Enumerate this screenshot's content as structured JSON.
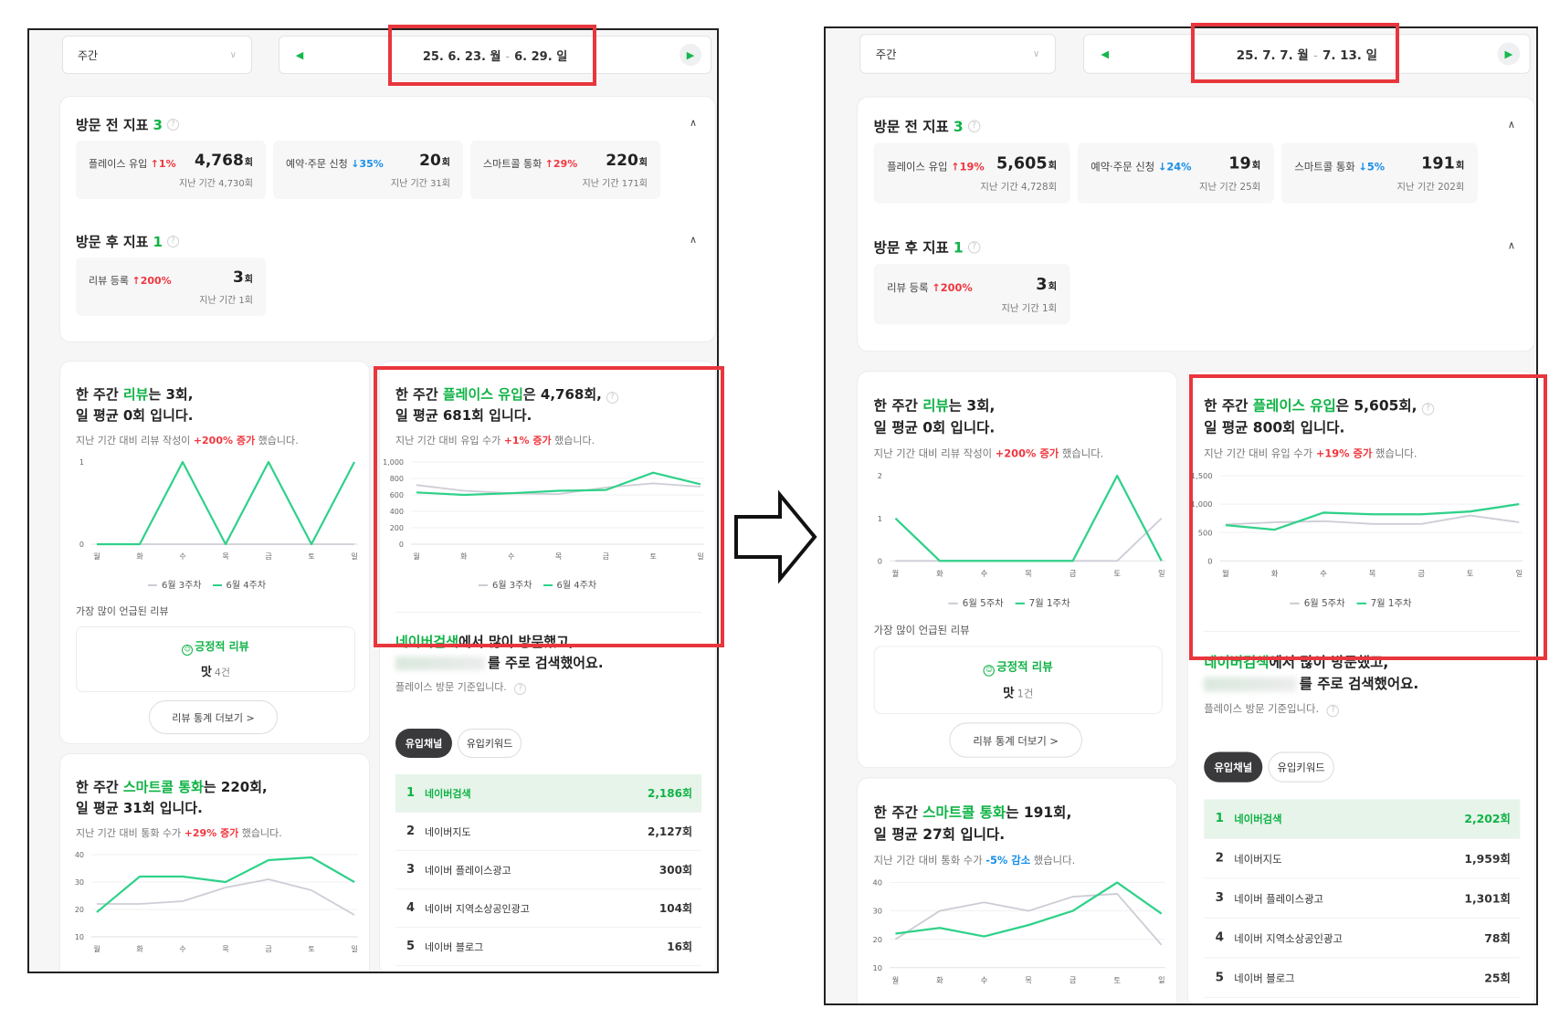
{
  "colors": {
    "accent_green": "#10b346",
    "increase_red": "#f0373e",
    "decrease_blue": "#1a8fe8",
    "previous_gray": "#cdcdd6",
    "highlight_red": "#e8363c"
  },
  "icons": {
    "prev_arrow": "triangle-left-icon",
    "next_arrow": "triangle-right-icon",
    "help": "question-circle-icon",
    "transition": "outline-right-arrow-icon",
    "positive": "smiley-icon"
  },
  "left": {
    "period": "주간",
    "date_start": "25. 6. 23. 월",
    "date_end": "6. 29. 일",
    "pre_title": "방문 전 지표",
    "pre_count": "3",
    "metrics": [
      {
        "label": "플레이스 유입",
        "change": "↑1%",
        "value": "4,768",
        "unit": "회",
        "prev": "지난 기간 4,730회"
      },
      {
        "label": "예약·주문 신청",
        "change": "↓35%",
        "value": "20",
        "unit": "회",
        "prev": "지난 기간 31회"
      },
      {
        "label": "스마트콜 통화",
        "change": "↑29%",
        "value": "220",
        "unit": "회",
        "prev": "지난 기간 171회"
      }
    ],
    "post_title": "방문 후 지표",
    "post_count": "1",
    "post_metric": {
      "label": "리뷰 등록",
      "change": "↑200%",
      "value": "3",
      "unit": "회",
      "prev": "지난 기간 1회"
    },
    "review_card": {
      "l1a": "한 주간 ",
      "l1hl": "리뷰",
      "l1b": "는 3회,",
      "l2": "일 평균 0회 입니다.",
      "sub_a": "지난 기간 대비 리뷰 작성이 ",
      "sub_hl": "+200% 증가",
      "sub_b": " 했습니다.",
      "most": "가장 많이 언급된 리뷰",
      "positive": "긍정적 리뷰",
      "keyword": "맛",
      "keyword_count": "4건",
      "more": "리뷰 통계 더보기 >"
    },
    "place_card": {
      "l1a": "한 주간 ",
      "l1hl": "플레이스 유입",
      "l1b": "은 4,768회,",
      "l2": "일 평균 681회 입니다.",
      "sub_a": "지난 기간 대비 유입 수가 ",
      "sub_hl": "+1% 증가",
      "sub_b": " 했습니다."
    },
    "call_card": {
      "l1a": "한 주간 ",
      "l1hl": "스마트콜 통화",
      "l1b": "는 220회,",
      "l2": "일 평균 31회 입니다.",
      "sub_a": "지난 기간 대비 통화 수가 ",
      "sub_hl": "+29% 증가",
      "sub_b": " 했습니다."
    },
    "channel": {
      "l1hl": "네이버검색",
      "l1b": "에서 많이 방문했고,",
      "l2": "를 주로 검색했어요.",
      "sub": "플레이스 방문 기준입니다.",
      "tab_on": "유입채널",
      "tab_off": "유입키워드",
      "rows": [
        {
          "rank": "1",
          "name": "네이버검색",
          "value": "2,186회"
        },
        {
          "rank": "2",
          "name": "네이버지도",
          "value": "2,127회"
        },
        {
          "rank": "3",
          "name": "네이버 플레이스광고",
          "value": "300회"
        },
        {
          "rank": "4",
          "name": "네이버 지역소상공인광고",
          "value": "104회"
        },
        {
          "rank": "5",
          "name": "네이버 블로그",
          "value": "16회"
        }
      ]
    }
  },
  "right": {
    "period": "주간",
    "date_start": "25. 7. 7. 월",
    "date_end": "7. 13. 일",
    "pre_title": "방문 전 지표",
    "pre_count": "3",
    "metrics": [
      {
        "label": "플레이스 유입",
        "change": "↑19%",
        "value": "5,605",
        "unit": "회",
        "prev": "지난 기간 4,728회"
      },
      {
        "label": "예약·주문 신청",
        "change": "↓24%",
        "value": "19",
        "unit": "회",
        "prev": "지난 기간 25회"
      },
      {
        "label": "스마트콜 통화",
        "change": "↓5%",
        "value": "191",
        "unit": "회",
        "prev": "지난 기간 202회"
      }
    ],
    "post_title": "방문 후 지표",
    "post_count": "1",
    "post_metric": {
      "label": "리뷰 등록",
      "change": "↑200%",
      "value": "3",
      "unit": "회",
      "prev": "지난 기간 1회"
    },
    "review_card": {
      "l1a": "한 주간 ",
      "l1hl": "리뷰",
      "l1b": "는 3회,",
      "l2": "일 평균 0회 입니다.",
      "sub_a": "지난 기간 대비 리뷰 작성이 ",
      "sub_hl": "+200% 증가",
      "sub_b": " 했습니다.",
      "most": "가장 많이 언급된 리뷰",
      "positive": "긍정적 리뷰",
      "keyword": "맛",
      "keyword_count": "1건",
      "more": "리뷰 통계 더보기 >"
    },
    "place_card": {
      "l1a": "한 주간 ",
      "l1hl": "플레이스 유입",
      "l1b": "은 5,605회,",
      "l2": "일 평균 800회 입니다.",
      "sub_a": "지난 기간 대비 유입 수가 ",
      "sub_hl": "+19% 증가",
      "sub_b": " 했습니다."
    },
    "call_card": {
      "l1a": "한 주간 ",
      "l1hl": "스마트콜 통화",
      "l1b": "는 191회,",
      "l2": "일 평균 27회 입니다.",
      "sub_a": "지난 기간 대비 통화 수가 ",
      "sub_hl": "-5% 감소",
      "sub_b": " 했습니다."
    },
    "channel": {
      "l1hl": "네이버검색",
      "l1b": "에서 많이 방문했고,",
      "l2": "를 주로 검색했어요.",
      "sub": "플레이스 방문 기준입니다.",
      "tab_on": "유입채널",
      "tab_off": "유입키워드",
      "rows": [
        {
          "rank": "1",
          "name": "네이버검색",
          "value": "2,202회"
        },
        {
          "rank": "2",
          "name": "네이버지도",
          "value": "1,959회"
        },
        {
          "rank": "3",
          "name": "네이버 플레이스광고",
          "value": "1,301회"
        },
        {
          "rank": "4",
          "name": "네이버 지역소상공인광고",
          "value": "78회"
        },
        {
          "rank": "5",
          "name": "네이버 블로그",
          "value": "25회"
        }
      ]
    }
  },
  "chart_data": [
    {
      "panel": "left",
      "chart": "review",
      "type": "line",
      "categories": [
        "월",
        "화",
        "수",
        "목",
        "금",
        "토",
        "일"
      ],
      "ylim": [
        0,
        1
      ],
      "yticks": [
        "0",
        "1"
      ],
      "grid": false,
      "legend": "bottom",
      "series": [
        {
          "name": "6월 3주차",
          "values": [
            0,
            0,
            0,
            0,
            0,
            0,
            0
          ]
        },
        {
          "name": "6월 4주차",
          "values": [
            0,
            0,
            1,
            0,
            1,
            0,
            1
          ]
        }
      ]
    },
    {
      "panel": "left",
      "chart": "place",
      "type": "line",
      "categories": [
        "월",
        "화",
        "수",
        "목",
        "금",
        "토",
        "일"
      ],
      "ylim": [
        0,
        1000
      ],
      "yticks": [
        "0",
        "200",
        "400",
        "600",
        "800",
        "1,000"
      ],
      "grid": true,
      "legend": "bottom",
      "series": [
        {
          "name": "6월 3주차",
          "values": [
            720,
            650,
            620,
            610,
            690,
            740,
            700
          ]
        },
        {
          "name": "6월 4주차",
          "values": [
            630,
            600,
            620,
            650,
            660,
            870,
            730
          ]
        }
      ]
    },
    {
      "panel": "left",
      "chart": "call",
      "type": "line",
      "categories": [
        "월",
        "화",
        "수",
        "목",
        "금",
        "토",
        "일"
      ],
      "ylim": [
        10,
        40
      ],
      "yticks": [
        "10",
        "20",
        "30",
        "40"
      ],
      "grid": true,
      "legend": "bottom",
      "series": [
        {
          "name": "6월 3주차",
          "values": [
            22,
            22,
            23,
            28,
            31,
            27,
            18
          ]
        },
        {
          "name": "6월 4주차",
          "values": [
            19,
            32,
            32,
            30,
            38,
            39,
            30
          ]
        }
      ]
    },
    {
      "panel": "right",
      "chart": "review",
      "type": "line",
      "categories": [
        "월",
        "화",
        "수",
        "목",
        "금",
        "토",
        "일"
      ],
      "ylim": [
        0,
        2
      ],
      "yticks": [
        "0",
        "1",
        "2"
      ],
      "grid": false,
      "legend": "bottom",
      "series": [
        {
          "name": "6월 5주차",
          "values": [
            0,
            0,
            0,
            0,
            0,
            0,
            1
          ]
        },
        {
          "name": "7월 1주차",
          "values": [
            1,
            0,
            0,
            0,
            0,
            2,
            0
          ]
        }
      ]
    },
    {
      "panel": "right",
      "chart": "place",
      "type": "line",
      "categories": [
        "월",
        "화",
        "수",
        "목",
        "금",
        "토",
        "일"
      ],
      "ylim": [
        0,
        1500
      ],
      "yticks": [
        "0",
        "500",
        "1,000",
        "1,500"
      ],
      "grid": true,
      "legend": "bottom",
      "series": [
        {
          "name": "6월 5주차",
          "values": [
            640,
            680,
            700,
            650,
            650,
            800,
            680
          ]
        },
        {
          "name": "7월 1주차",
          "values": [
            630,
            550,
            850,
            820,
            820,
            870,
            1000
          ]
        }
      ]
    },
    {
      "panel": "right",
      "chart": "call",
      "type": "line",
      "categories": [
        "월",
        "화",
        "수",
        "목",
        "금",
        "토",
        "일"
      ],
      "ylim": [
        10,
        40
      ],
      "yticks": [
        "10",
        "20",
        "30",
        "40"
      ],
      "grid": true,
      "legend": "bottom",
      "series": [
        {
          "name": "6월 5주차",
          "values": [
            20,
            30,
            33,
            30,
            35,
            36,
            18
          ]
        },
        {
          "name": "7월 1주차",
          "values": [
            22,
            24,
            21,
            25,
            30,
            40,
            29
          ]
        }
      ]
    }
  ]
}
